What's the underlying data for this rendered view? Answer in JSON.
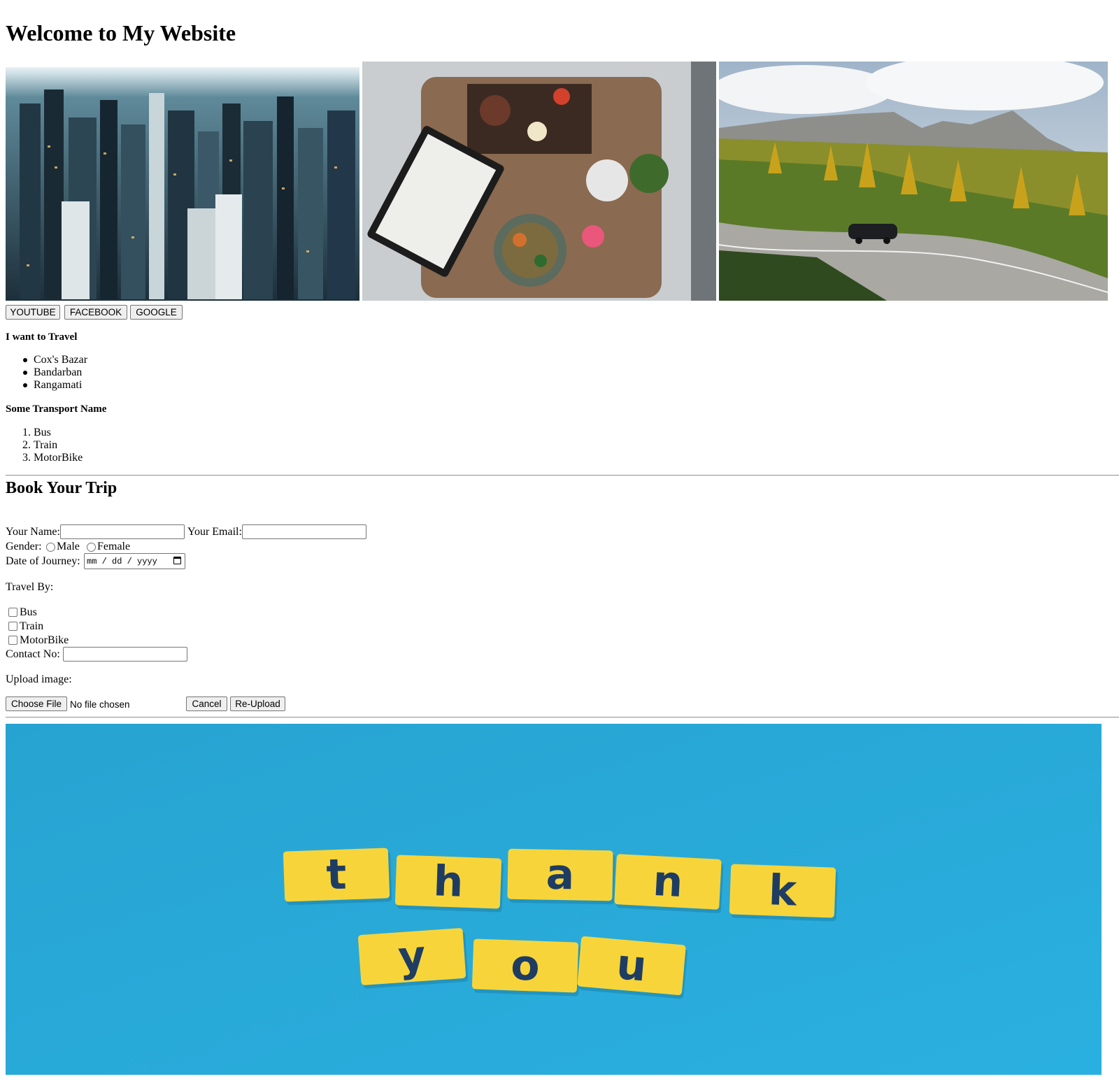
{
  "page": {
    "title": "Welcome to My Website"
  },
  "images": {
    "city": "city-skyline-image",
    "food": "food-table-image",
    "mountain": "mountain-road-image",
    "thank_you": "thank-you-tiles-image"
  },
  "social_buttons": [
    "YOUTUBE",
    "FACEBOOK",
    "GOOGLE"
  ],
  "travel": {
    "heading": "I want to Travel",
    "places": [
      "Cox's Bazar",
      "Bandarban",
      "Rangamati"
    ]
  },
  "transport": {
    "heading": "Some Transport Name",
    "items": [
      {
        "num": "1.",
        "label": "Bus"
      },
      {
        "num": "2.",
        "label": "Train"
      },
      {
        "num": "3.",
        "label": "MotorBike"
      }
    ]
  },
  "form": {
    "heading": "Book Your Trip",
    "name_label": "Your Name:",
    "email_label": "Your Email:",
    "gender_label": "Gender:",
    "gender_options": [
      "Male",
      "Female"
    ],
    "date_label": "Date of Journey:",
    "date_placeholder": "mm / dd / yyyy",
    "travel_by_label": "Travel By:",
    "travel_options": [
      "Bus",
      "Train",
      "MotorBike"
    ],
    "contact_label": "Contact No:",
    "upload_label": "Upload image:",
    "choose_file": "Choose File",
    "no_file": "No file chosen",
    "cancel": "Cancel",
    "reupload": "Re-Upload"
  },
  "thank_tiles": {
    "row1": [
      "t",
      "h",
      "a",
      "n",
      "k"
    ],
    "row2": [
      "y",
      "o",
      "u"
    ]
  },
  "colors": {
    "tile_yellow": "#f7d53a",
    "tile_letter": "#1f3d63",
    "sky_blue": "#2aa6d5"
  }
}
